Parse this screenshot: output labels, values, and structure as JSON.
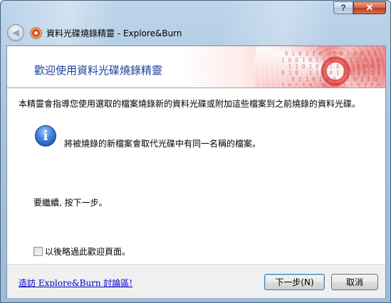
{
  "window": {
    "title": "資料光碟燒錄精靈 - Explore&Burn",
    "help_glyph": "?",
    "close_glyph": "✕",
    "back_glyph": "◀"
  },
  "banner": {
    "heading": "歡迎使用資料光碟燒錄精靈"
  },
  "body": {
    "intro": "本精靈會指導您使用選取的檔案燒錄新的資料光碟或附加這些檔案到之前燒錄的資料光碟。",
    "info_glyph": "i",
    "info": "將被燒錄的新檔案會取代光碟中有同一名稱的檔案。",
    "continue": "要繼續, 按下一步。",
    "skip_checkbox": {
      "label": "以後略過此歡迎頁面。",
      "checked": false
    }
  },
  "footer": {
    "forum_link": "造訪 Explore&Burn 討論區!",
    "next_label": "下一步(N)",
    "cancel_label": "取消"
  },
  "colors": {
    "heading": "#1e3e9c",
    "link": "#0000cc",
    "close_button": "#c2361e"
  },
  "icons": [
    "help-icon",
    "close-icon",
    "back-arrow-icon",
    "app-disc-icon",
    "info-icon",
    "cd-disc-graphic"
  ]
}
